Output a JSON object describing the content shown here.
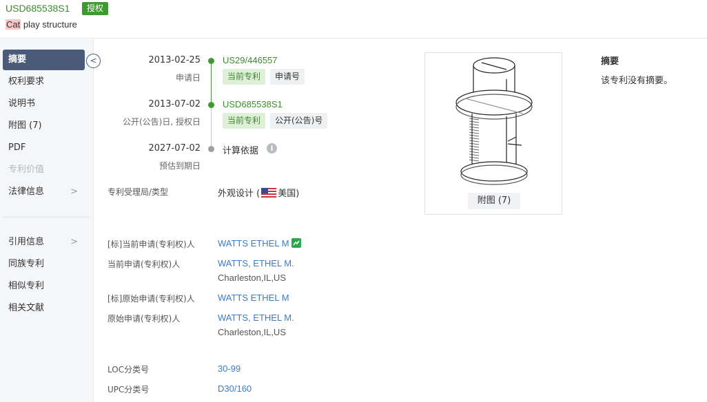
{
  "header": {
    "patent_number": "USD685538S1",
    "status_badge": "授权",
    "title_highlight": "Cat",
    "title_rest": " play structure"
  },
  "sidebar": {
    "items": [
      {
        "label": "摘要",
        "state": "active"
      },
      {
        "label": "权利要求",
        "state": "normal"
      },
      {
        "label": "说明书",
        "state": "normal"
      },
      {
        "label": "附图 (7)",
        "state": "normal"
      },
      {
        "label": "PDF",
        "state": "normal"
      },
      {
        "label": "专利价值",
        "state": "disabled"
      },
      {
        "label": "法律信息",
        "state": "normal",
        "chevron": ">"
      },
      {
        "label": "引用信息",
        "state": "normal",
        "chevron": ">"
      },
      {
        "label": "同族专利",
        "state": "normal"
      },
      {
        "label": "相似专利",
        "state": "normal"
      },
      {
        "label": "相关文献",
        "state": "normal"
      }
    ],
    "collapse_glyph": "<"
  },
  "timeline": {
    "events": [
      {
        "date": "2013-02-25",
        "label": "申请日",
        "number": "US29/446557",
        "tags": [
          "当前专利",
          "申请号"
        ]
      },
      {
        "date": "2013-07-02",
        "label": "公开(公告)日, 授权日",
        "number": "USD685538S1",
        "tags": [
          "当前专利",
          "公开(公告)号"
        ]
      },
      {
        "date": "2027-07-02",
        "label": "预估到期日",
        "text": "计算依据",
        "info_glyph": "i"
      }
    ]
  },
  "fields": {
    "office_label": "专利受理局/类型",
    "office_type": "外观设计 (",
    "office_country": "美国)",
    "std_current_applicant_label": "[标]当前申请(专利权)人",
    "std_current_applicant": "WATTS ETHEL M",
    "current_applicant_label": "当前申请(专利权)人",
    "current_applicant": "WATTS, ETHEL M.",
    "current_applicant_addr": "Charleston,IL,US",
    "std_original_applicant_label": "[标]原始申请(专利权)人",
    "std_original_applicant": "WATTS ETHEL M",
    "original_applicant_label": "原始申请(专利权)人",
    "original_applicant": "WATTS, ETHEL M.",
    "original_applicant_addr": "Charleston,IL,US",
    "loc_label": "LOC分类号",
    "loc_value": "30-99",
    "upc_label": "UPC分类号",
    "upc_value": "D30/160"
  },
  "figure": {
    "button_label": "附图 (7)"
  },
  "abstract": {
    "title": "摘要",
    "text": "该专利没有摘要。"
  },
  "colors": {
    "accent_green": "#3d9a2e",
    "link_blue": "#3a7bc8",
    "sidebar_active": "#4a5a78"
  }
}
